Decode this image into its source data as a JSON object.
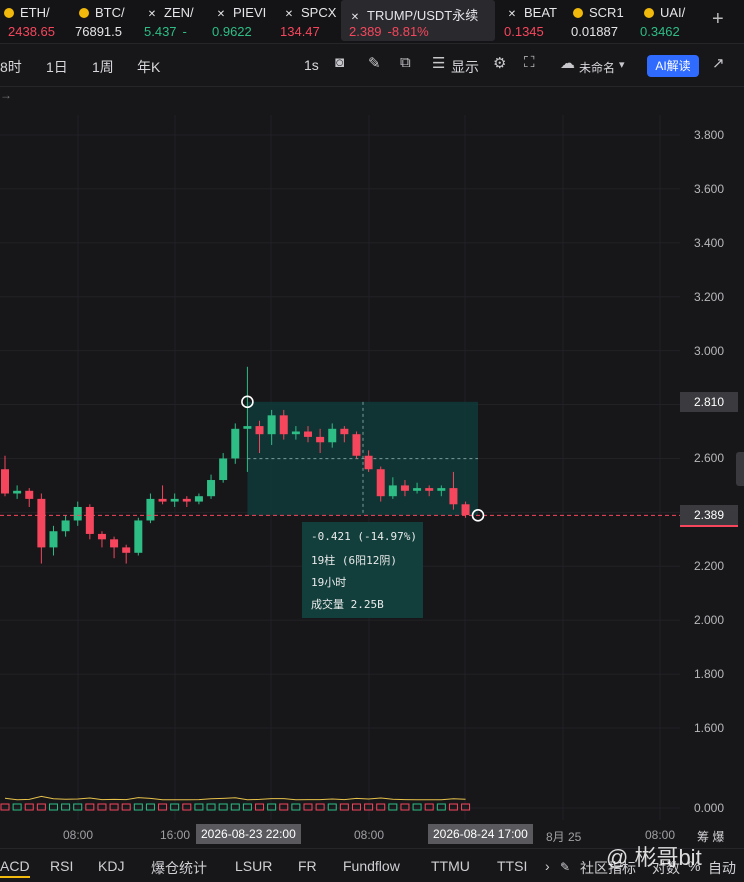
{
  "tickers": [
    {
      "symbol": "ETH/",
      "price": "2438.65",
      "trend": "down",
      "icon": "coin-icon"
    },
    {
      "symbol": "BTC/",
      "price": "76891.5",
      "trend": "neutral",
      "icon": "coin-icon"
    },
    {
      "symbol": "ZEN/",
      "price": "5.437",
      "change": "-",
      "trend": "up",
      "icon": "x-icon"
    },
    {
      "symbol": "PIEVI",
      "price": "0.9622",
      "trend": "up",
      "icon": "x-icon"
    },
    {
      "symbol": "SPCX",
      "price": "134.47",
      "trend": "down",
      "icon": "x-icon"
    },
    {
      "symbol": "TRUMP/USDT永续",
      "price": "2.389",
      "change": "-8.81%",
      "trend": "down",
      "icon": "x-icon",
      "active": true
    },
    {
      "symbol": "BEAT",
      "price": "0.1345",
      "trend": "down",
      "icon": "x-icon"
    },
    {
      "symbol": "SCR1",
      "price": "0.01887",
      "trend": "neutral",
      "icon": "coin-icon"
    },
    {
      "symbol": "UAI/",
      "price": "0.3462",
      "trend": "up",
      "icon": "coin-icon"
    }
  ],
  "add_tab": "+",
  "toolbar": {
    "intervals": [
      "8时",
      "1日",
      "1周",
      "年K"
    ],
    "active_interval": "1s",
    "display_label": "显示",
    "layout_name": "未命名",
    "ai_label": "AI解读"
  },
  "sub_arrow": "→",
  "chart_data": {
    "type": "candlestick",
    "price_axis": {
      "min": 0.0,
      "max": 3.8,
      "ticks": [
        "3.800",
        "3.600",
        "3.400",
        "3.200",
        "3.000",
        "2.800",
        "2.600",
        "2.400",
        "2.200",
        "2.000",
        "1.800",
        "1.600",
        "0.000"
      ]
    },
    "candles": [
      {
        "o": 2.56,
        "c": 2.47,
        "h": 2.61,
        "l": 2.46
      },
      {
        "o": 2.47,
        "c": 2.48,
        "h": 2.5,
        "l": 2.45
      },
      {
        "o": 2.48,
        "c": 2.45,
        "h": 2.49,
        "l": 2.42
      },
      {
        "o": 2.45,
        "c": 2.27,
        "h": 2.47,
        "l": 2.21
      },
      {
        "o": 2.27,
        "c": 2.33,
        "h": 2.35,
        "l": 2.24
      },
      {
        "o": 2.33,
        "c": 2.37,
        "h": 2.39,
        "l": 2.31
      },
      {
        "o": 2.37,
        "c": 2.42,
        "h": 2.44,
        "l": 2.35
      },
      {
        "o": 2.42,
        "c": 2.32,
        "h": 2.43,
        "l": 2.3
      },
      {
        "o": 2.32,
        "c": 2.3,
        "h": 2.33,
        "l": 2.27
      },
      {
        "o": 2.3,
        "c": 2.27,
        "h": 2.31,
        "l": 2.23
      },
      {
        "o": 2.27,
        "c": 2.25,
        "h": 2.28,
        "l": 2.21
      },
      {
        "o": 2.25,
        "c": 2.37,
        "h": 2.38,
        "l": 2.24
      },
      {
        "o": 2.37,
        "c": 2.45,
        "h": 2.47,
        "l": 2.36
      },
      {
        "o": 2.45,
        "c": 2.44,
        "h": 2.5,
        "l": 2.43
      },
      {
        "o": 2.44,
        "c": 2.45,
        "h": 2.47,
        "l": 2.42
      },
      {
        "o": 2.45,
        "c": 2.44,
        "h": 2.46,
        "l": 2.42
      },
      {
        "o": 2.44,
        "c": 2.46,
        "h": 2.47,
        "l": 2.43
      },
      {
        "o": 2.46,
        "c": 2.52,
        "h": 2.54,
        "l": 2.45
      },
      {
        "o": 2.52,
        "c": 2.6,
        "h": 2.62,
        "l": 2.51
      },
      {
        "o": 2.6,
        "c": 2.71,
        "h": 2.73,
        "l": 2.58
      },
      {
        "o": 2.71,
        "c": 2.72,
        "h": 2.94,
        "l": 2.55
      },
      {
        "o": 2.72,
        "c": 2.69,
        "h": 2.74,
        "l": 2.62
      },
      {
        "o": 2.69,
        "c": 2.76,
        "h": 2.78,
        "l": 2.65
      },
      {
        "o": 2.76,
        "c": 2.69,
        "h": 2.78,
        "l": 2.67
      },
      {
        "o": 2.69,
        "c": 2.7,
        "h": 2.72,
        "l": 2.67
      },
      {
        "o": 2.7,
        "c": 2.68,
        "h": 2.72,
        "l": 2.66
      },
      {
        "o": 2.68,
        "c": 2.66,
        "h": 2.71,
        "l": 2.62
      },
      {
        "o": 2.66,
        "c": 2.71,
        "h": 2.73,
        "l": 2.64
      },
      {
        "o": 2.71,
        "c": 2.69,
        "h": 2.72,
        "l": 2.66
      },
      {
        "o": 2.69,
        "c": 2.61,
        "h": 2.7,
        "l": 2.6
      },
      {
        "o": 2.61,
        "c": 2.56,
        "h": 2.63,
        "l": 2.55
      },
      {
        "o": 2.56,
        "c": 2.46,
        "h": 2.57,
        "l": 2.44
      },
      {
        "o": 2.46,
        "c": 2.5,
        "h": 2.53,
        "l": 2.45
      },
      {
        "o": 2.5,
        "c": 2.48,
        "h": 2.52,
        "l": 2.46
      },
      {
        "o": 2.48,
        "c": 2.49,
        "h": 2.51,
        "l": 2.47
      },
      {
        "o": 2.49,
        "c": 2.48,
        "h": 2.5,
        "l": 2.46
      },
      {
        "o": 2.48,
        "c": 2.49,
        "h": 2.5,
        "l": 2.46
      },
      {
        "o": 2.49,
        "c": 2.43,
        "h": 2.55,
        "l": 2.41
      },
      {
        "o": 2.43,
        "c": 2.39,
        "h": 2.44,
        "l": 2.38
      }
    ],
    "current_price": "2.389",
    "measure_high": "2.810",
    "measure": {
      "change": "-0.421 (-14.97%)",
      "bars": "19柱 (6阳12阴)",
      "duration": "19小时",
      "volume": "成交量 2.25B"
    },
    "time_axis": [
      {
        "label": "08:00"
      },
      {
        "label": "16:00"
      },
      {
        "label": "2026-08-23 22:00",
        "highlight": true
      },
      {
        "label": "08:00"
      },
      {
        "label": "2026-08-24 17:00",
        "highlight": true
      },
      {
        "label": "8月 25"
      },
      {
        "label": "08:00"
      }
    ]
  },
  "time_axis_right": "筹 爆",
  "indicators": [
    "ACD",
    "RSI",
    "KDJ",
    "爆仓统计",
    "LSUR",
    "FR",
    "Fundflow",
    "TTMU",
    "TTSI",
    "›",
    "社区指标",
    "对数",
    "%",
    "自动"
  ],
  "watermark": "@ 彬哥bit",
  "colors": {
    "up": "#2ebd85",
    "down": "#f6465d",
    "accent": "#f0b90b",
    "ai": "#2f6bff"
  }
}
